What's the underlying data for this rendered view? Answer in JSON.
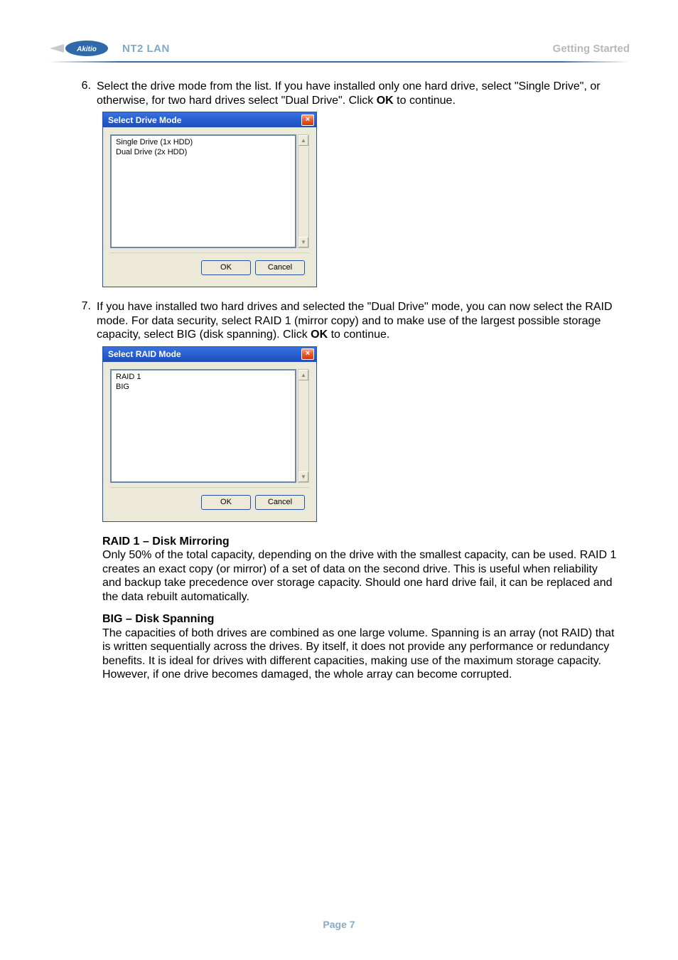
{
  "header": {
    "product": "NT2 LAN",
    "section": "Getting Started"
  },
  "step6": {
    "number": "6.",
    "text_before_ok": "Select the drive mode from the list. If you have installed only one hard drive, select \"Single Drive\", or otherwise, for two hard drives select \"Dual Drive\". Click ",
    "ok_word": "OK",
    "text_after_ok": " to continue."
  },
  "dialog_drive": {
    "title": "Select Drive Mode",
    "options": [
      "Single Drive (1x HDD)",
      "Dual Drive (2x HDD)"
    ],
    "ok": "OK",
    "cancel": "Cancel"
  },
  "step7": {
    "number": "7.",
    "text_before_ok": "If you have installed two hard drives and selected the \"Dual Drive\" mode, you can now select the RAID mode. For data security, select RAID 1 (mirror copy) and to make use of the largest possible storage capacity, select BIG (disk spanning). Click ",
    "ok_word": "OK",
    "text_after_ok": " to continue."
  },
  "dialog_raid": {
    "title": "Select RAID Mode",
    "options": [
      "RAID 1",
      "BIG"
    ],
    "ok": "OK",
    "cancel": "Cancel"
  },
  "raid1": {
    "heading": "RAID 1 – Disk Mirroring",
    "body": "Only 50% of the total capacity, depending on the drive with the smallest capacity, can be used. RAID 1 creates an exact copy (or mirror) of a set of data on the second drive. This is useful when reliability and backup take precedence over storage capacity. Should one hard drive fail, it can be replaced and the data rebuilt automatically."
  },
  "big": {
    "heading": "BIG – Disk Spanning",
    "body": "The capacities of both drives are combined as one large volume. Spanning is an array (not RAID) that is written sequentially across the drives. By itself, it does not provide any performance or redundancy benefits. It is ideal for drives with different capacities, making use of the maximum storage capacity. However, if one drive becomes damaged, the whole array can become corrupted."
  },
  "footer": {
    "page_label": "Page 7"
  }
}
